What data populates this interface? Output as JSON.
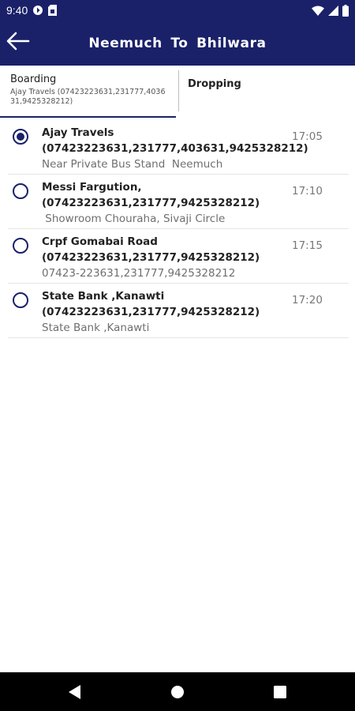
{
  "status_bar": {
    "time": "9:40",
    "icons": [
      "data-saver-icon",
      "sim-card-icon",
      "wifi-icon",
      "signal-icon",
      "battery-icon"
    ]
  },
  "app_bar": {
    "title": "Neemuch To Bhilwara",
    "back_icon": "arrow-back-icon",
    "color": "#1a2169"
  },
  "tabs": {
    "boarding": {
      "label": "Boarding",
      "selected_value": "Ajay Travels (07423223631,231777,403631,9425328212)"
    },
    "dropping": {
      "label": "Dropping"
    }
  },
  "boarding_points": [
    {
      "name": "Ajay Travels (07423223631,231777,403631,9425328212)",
      "address": "Near Private Bus Stand  Neemuch",
      "time": "17:05",
      "selected": true
    },
    {
      "name": "Messi Fargution, (07423223631,231777,9425328212)",
      "address": " Showroom Chouraha, Sivaji Circle",
      "time": "17:10",
      "selected": false
    },
    {
      "name": "Crpf Gomabai Road (07423223631,231777,9425328212)",
      "address": "07423-223631,231777,9425328212",
      "time": "17:15",
      "selected": false
    },
    {
      "name": "State Bank ,Kanawti (07423223631,231777,9425328212)",
      "address": "State Bank ,Kanawti",
      "time": "17:20",
      "selected": false
    }
  ],
  "nav_bar": {
    "icons": [
      "back-triangle-icon",
      "home-circle-icon",
      "recents-square-icon"
    ]
  }
}
